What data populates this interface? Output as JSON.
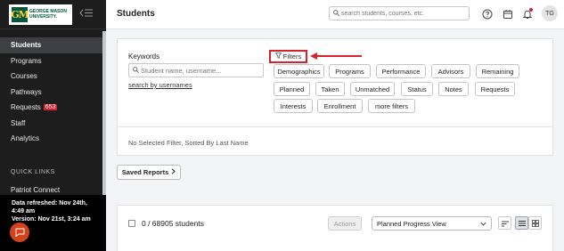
{
  "brand": {
    "mark": "GM",
    "line1": "GEORGE MASON",
    "line2": "UNIVERSITY."
  },
  "sidebar": {
    "items": [
      {
        "label": "Students"
      },
      {
        "label": "Programs"
      },
      {
        "label": "Courses"
      },
      {
        "label": "Pathways"
      },
      {
        "label": "Requests",
        "badge": "653"
      },
      {
        "label": "Staff"
      },
      {
        "label": "Analytics"
      }
    ],
    "quick_links_heading": "QUICK LINKS",
    "quick_links": [
      {
        "label": "Patriot Connect"
      }
    ],
    "refresh": {
      "line1": "Data refreshed: Nov 24th,",
      "line2": "4:49 am",
      "line3": "Version: Nov 21st, 3:24 am"
    }
  },
  "header": {
    "title": "Students",
    "search_placeholder": "search students, courses, etc.",
    "avatar_initials": "TG"
  },
  "filters": {
    "keywords_label": "Keywords",
    "keyword_placeholder": "Student name, username...",
    "search_by_usernames": "search by usernames",
    "filters_label": "Filters",
    "chips": [
      "Demographics",
      "Programs",
      "Performance",
      "Advisors",
      "Remaining",
      "Planned",
      "Taken",
      "Unmatched",
      "Status",
      "Notes",
      "Requests",
      "Interests",
      "Enrollment",
      "more filters"
    ],
    "status": "No Selected Filter, Sorted By Last Name"
  },
  "saved_reports": {
    "label": "Saved Reports"
  },
  "results": {
    "count": "0 / 68905 students",
    "actions_label": "Actions",
    "view_selected": "Planned Progress View"
  },
  "colors": {
    "accent_red": "#d8212f",
    "sidebar_bg": "#1d1d1d",
    "brand_green": "#00573d",
    "brand_gold": "#ffcc33",
    "chat_orange": "#d2421d"
  }
}
